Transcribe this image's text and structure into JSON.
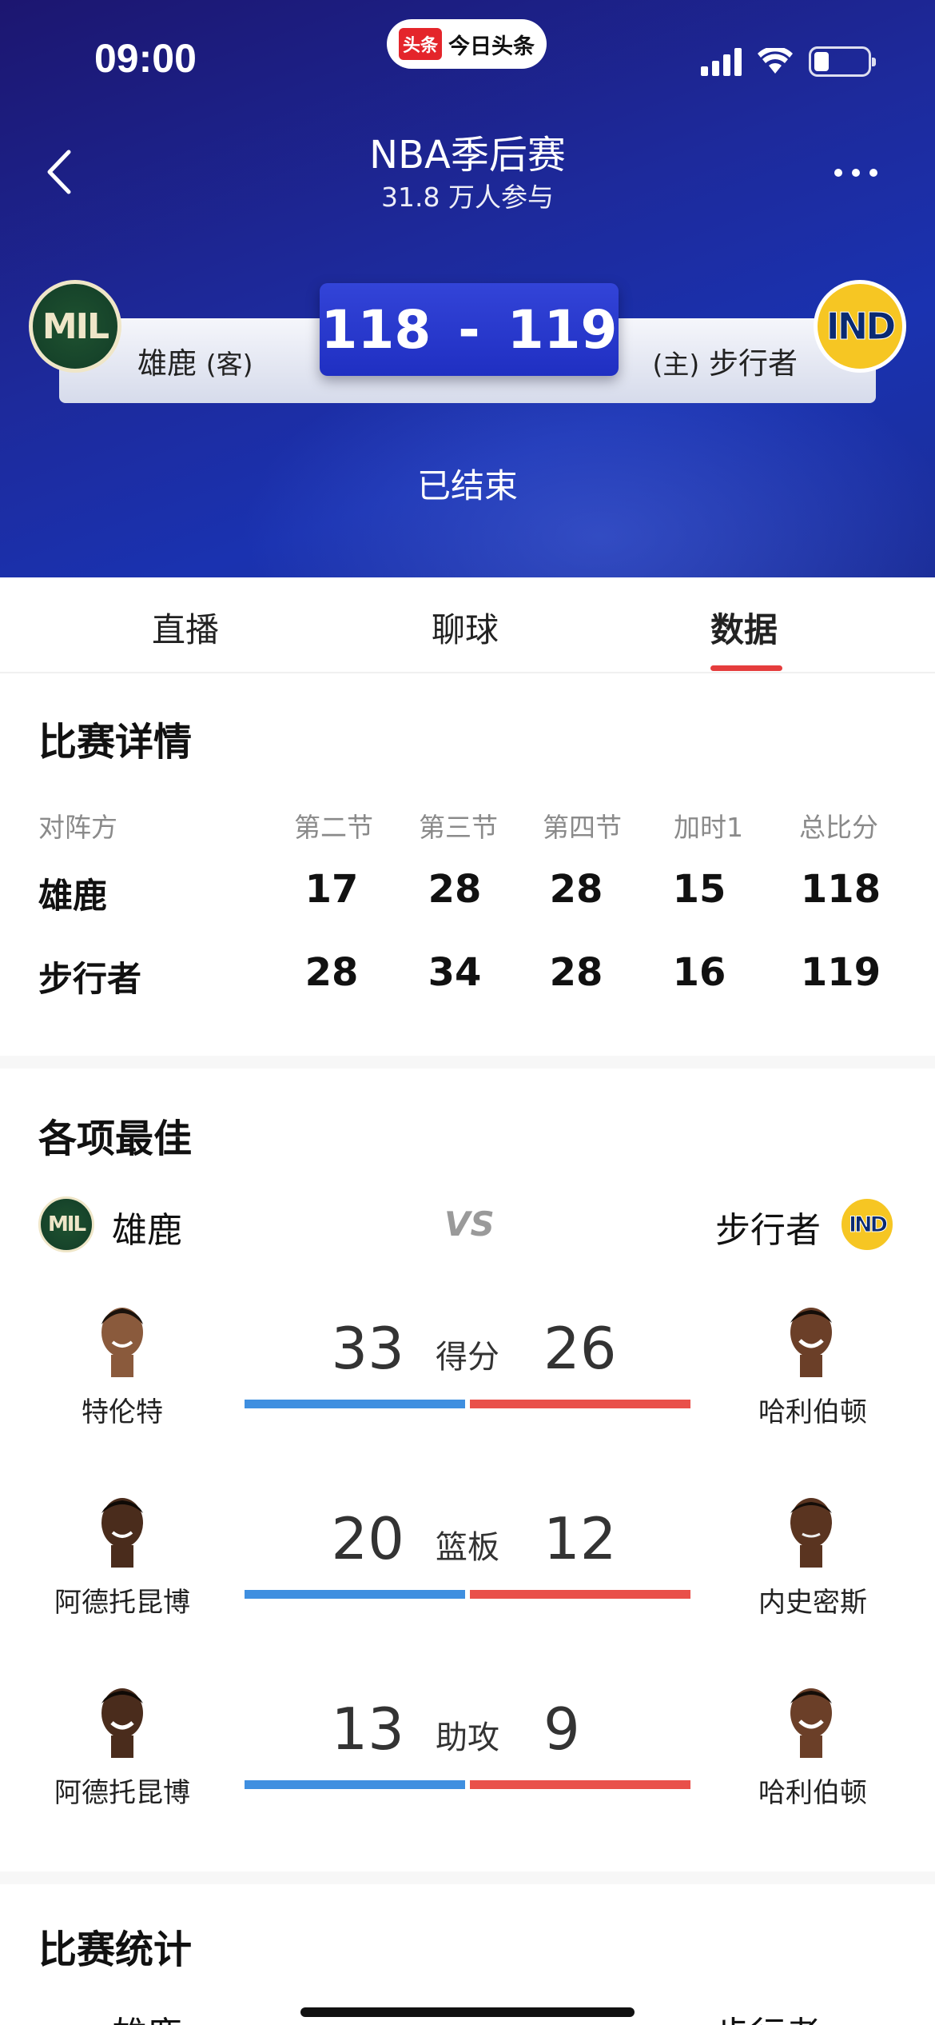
{
  "status_bar": {
    "time": "09:00"
  },
  "app_pill": {
    "tag": "头条",
    "name": "今日头条"
  },
  "header": {
    "title": "NBA季后赛",
    "subtitle": "31.8 万人参与",
    "status": "已结束"
  },
  "match": {
    "away": {
      "logo": "MIL",
      "name": "雄鹿",
      "tag": "(客)",
      "score": "118"
    },
    "home": {
      "logo": "IND",
      "name": "步行者",
      "tag": "(主)",
      "score": "119"
    },
    "separator": "-"
  },
  "tabs": [
    {
      "label": "直播",
      "active": false
    },
    {
      "label": "聊球",
      "active": false
    },
    {
      "label": "数据",
      "active": true
    }
  ],
  "details": {
    "title": "比赛详情",
    "headers": [
      "对阵方",
      "第二节",
      "第三节",
      "第四节",
      "加时1",
      "总比分"
    ],
    "rows": [
      {
        "team": "雄鹿",
        "values": [
          "17",
          "28",
          "28",
          "15",
          "118"
        ]
      },
      {
        "team": "步行者",
        "values": [
          "28",
          "34",
          "28",
          "16",
          "119"
        ]
      }
    ]
  },
  "leaders": {
    "title": "各项最佳",
    "left_team": {
      "logo": "MIL",
      "name": "雄鹿"
    },
    "right_team": {
      "logo": "IND",
      "name": "步行者"
    },
    "vs": "VS",
    "stats": [
      {
        "label": "得分",
        "left_player": "特伦特",
        "left_value": "33",
        "right_player": "哈利伯顿",
        "right_value": "26"
      },
      {
        "label": "篮板",
        "left_player": "阿德托昆博",
        "left_value": "20",
        "right_player": "内史密斯",
        "right_value": "12"
      },
      {
        "label": "助攻",
        "left_player": "阿德托昆博",
        "left_value": "13",
        "right_player": "哈利伯顿",
        "right_value": "9"
      }
    ]
  },
  "game_stats": {
    "title": "比赛统计",
    "left_team": "雄鹿",
    "right_team": "步行者"
  },
  "colors": {
    "away_bar": "#3f8fe0",
    "home_bar": "#e9504a",
    "tab_indicator": "#e53d3d",
    "header_bg": "#1d2a9c"
  }
}
